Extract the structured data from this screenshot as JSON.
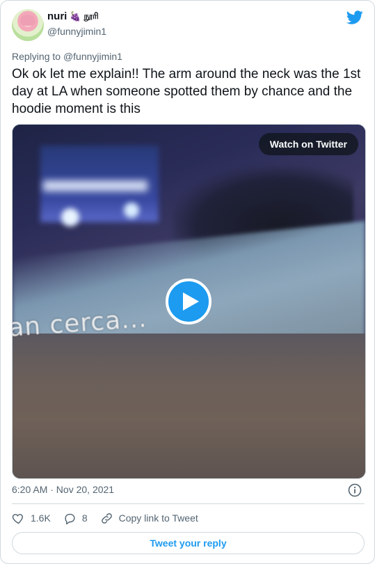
{
  "author": {
    "name": "nuri",
    "name_emoji": "🍇",
    "name_suffix": "நூரி",
    "handle": "@funnyjimin1",
    "avatar": "avatar-image"
  },
  "header": {
    "logo_icon": "twitter-bird-icon",
    "brand_color": "#1d9bf0"
  },
  "tweet": {
    "replying_to_prefix": "Replying to ",
    "replying_to_handle": "@funnyjimin1",
    "text": "Ok ok let me explain!! The arm around the neck was the 1st day at LA when someone spotted them by chance and the hoodie moment is this"
  },
  "media": {
    "type": "video",
    "watch_label": "Watch on Twitter",
    "overlay_caption": "an cerca...",
    "play_icon": "play-icon"
  },
  "meta": {
    "timestamp": "6:20 AM · Nov 20, 2021",
    "info_icon": "info-icon"
  },
  "actions": {
    "likes": "1.6K",
    "replies": "8",
    "copy_link_label": "Copy link to Tweet"
  },
  "reply_button_label": "Tweet your reply",
  "colors": {
    "text": "#0f1419",
    "muted": "#536471",
    "border": "#cfd9de",
    "accent": "#1d9bf0"
  }
}
